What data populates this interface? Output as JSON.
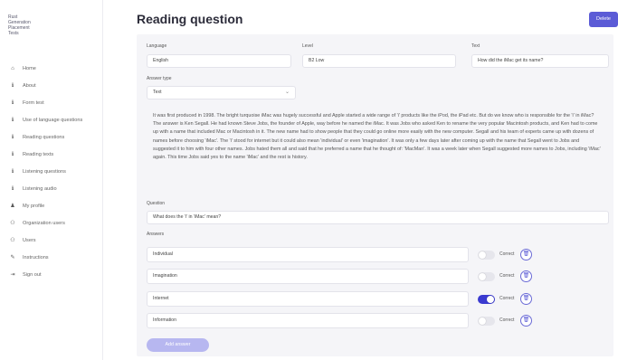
{
  "sidebar": {
    "logo_lines": [
      "Rust",
      "Generation",
      "Placement",
      "Tests"
    ],
    "items": [
      {
        "label": "Home",
        "icon": "home-icon",
        "glyph": "⌂"
      },
      {
        "label": "About",
        "icon": "info-icon",
        "glyph": "ℹ"
      },
      {
        "label": "Form test",
        "icon": "info-icon",
        "glyph": "ℹ"
      },
      {
        "label": "Use of language questions",
        "icon": "info-icon",
        "glyph": "ℹ"
      },
      {
        "label": "Reading questions",
        "icon": "info-icon",
        "glyph": "ℹ"
      },
      {
        "label": "Reading texts",
        "icon": "info-icon",
        "glyph": "ℹ"
      },
      {
        "label": "Listening questions",
        "icon": "info-icon",
        "glyph": "ℹ"
      },
      {
        "label": "Listening audio",
        "icon": "info-icon",
        "glyph": "ℹ"
      },
      {
        "label": "My profile",
        "icon": "user-icon",
        "glyph": "♟"
      },
      {
        "label": "Organization users",
        "icon": "users-icon",
        "glyph": "⚇"
      },
      {
        "label": "Users",
        "icon": "users-icon",
        "glyph": "⚇"
      },
      {
        "label": "Instructions",
        "icon": "wrench-icon",
        "glyph": "✎"
      },
      {
        "label": "Sign out",
        "icon": "sign-out-icon",
        "glyph": "⇥"
      }
    ]
  },
  "header": {
    "title": "Reading question",
    "delete_label": "Delete"
  },
  "form": {
    "language_label": "Language",
    "language_value": "English",
    "level_label": "Level",
    "level_value": "B2 Low",
    "text_label": "Text",
    "text_value": "How did the iMac get its name?",
    "answer_type_label": "Answer type",
    "answer_type_value": "Text",
    "passage": "It was first produced in 1998. The bright turquoise iMac was hugely successful and Apple started a wide range of 'i' products like the iPod, the iPad etc. But do we know who is responsible for the 'i' in iMac? The answer is Ken Segall. He had known Steve Jobs, the founder of Apple, way before he named the iMac. It was Jobs who asked Ken to rename the very popular Macintosh products, and Ken had to come up with a name that included Mac or Macintosh in it. The new name had to show people that they could go online more easily with the new computer. Segall and his team of experts came up with dozens of names before choosing 'iMac'. The 'i' stood for internet but it could also mean 'individual' or even 'imagination'. It was only a few days later after coming up with the name that Segall went to Jobs and suggested it to him with four other names. Jobs hated them all and said that he preferred a name that he thought of: 'MacMan'. It was a week later when Segall suggested more names to Jobs, including 'iMac' again. This time Jobs said yes to the name 'iMac' and the rest is history.",
    "question_label": "Question",
    "question_value": "What does the 'i' in 'iMac' mean?",
    "answers_label": "Answers",
    "correct_label": "Correct",
    "add_answer_label": "Add answer",
    "answers": [
      {
        "text": "Individual",
        "correct": false
      },
      {
        "text": "Imagination",
        "correct": false
      },
      {
        "text": "Internet",
        "correct": true
      },
      {
        "text": "Information",
        "correct": false
      }
    ]
  },
  "colors": {
    "accent": "#5b5bd6",
    "toggle_on": "#3a3ad0"
  }
}
